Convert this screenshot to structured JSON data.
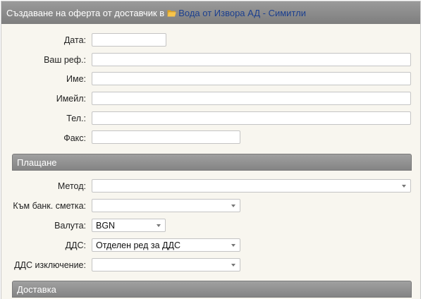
{
  "header": {
    "title": "Създаване на оферта от доставчик в",
    "link": "Вода от Извора АД - Симитли",
    "icon": "folder-open-icon",
    "icon_color": "#f2b631",
    "link_color": "#1b3f8f"
  },
  "contact_fields": {
    "date": {
      "label": "Дата:",
      "value": ""
    },
    "your_ref": {
      "label": "Ваш реф.:",
      "value": ""
    },
    "name": {
      "label": "Име:",
      "value": ""
    },
    "email": {
      "label": "Имейл:",
      "value": ""
    },
    "phone": {
      "label": "Тел.:",
      "value": ""
    },
    "fax": {
      "label": "Факс:",
      "value": ""
    }
  },
  "payment": {
    "section_title": "Плащане",
    "method": {
      "label": "Метод:",
      "value": ""
    },
    "bank_account": {
      "label": "Към банк. сметка:",
      "value": ""
    },
    "currency": {
      "label": "Валута:",
      "value": "BGN"
    },
    "vat": {
      "label": "ДДС:",
      "value": "Отделен ред за ДДС"
    },
    "vat_exception": {
      "label": "ДДС изключение:",
      "value": ""
    }
  },
  "delivery": {
    "section_title": "Доставка"
  }
}
